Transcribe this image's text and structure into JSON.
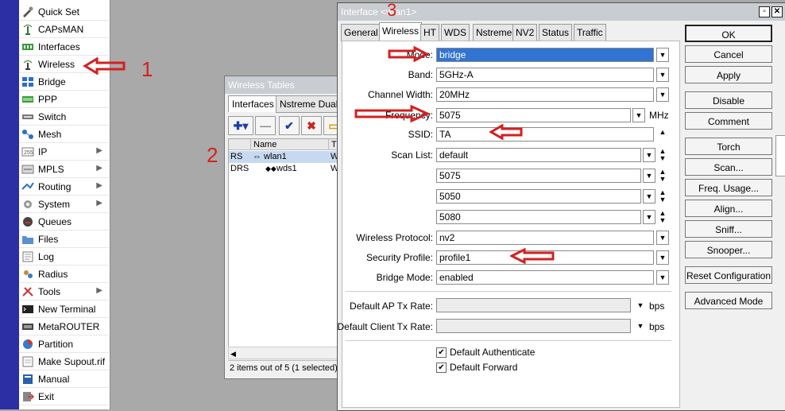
{
  "sidebar": {
    "items": [
      {
        "label": "Quick Set",
        "icon": "quick-set-icon"
      },
      {
        "label": "CAPsMAN",
        "icon": "capsman-icon"
      },
      {
        "label": "Interfaces",
        "icon": "interfaces-icon"
      },
      {
        "label": "Wireless",
        "icon": "wireless-icon"
      },
      {
        "label": "Bridge",
        "icon": "bridge-icon"
      },
      {
        "label": "PPP",
        "icon": "ppp-icon"
      },
      {
        "label": "Switch",
        "icon": "switch-icon"
      },
      {
        "label": "Mesh",
        "icon": "mesh-icon"
      },
      {
        "label": "IP",
        "icon": "ip-icon",
        "submenu": true
      },
      {
        "label": "MPLS",
        "icon": "mpls-icon",
        "submenu": true
      },
      {
        "label": "Routing",
        "icon": "routing-icon",
        "submenu": true
      },
      {
        "label": "System",
        "icon": "system-icon",
        "submenu": true
      },
      {
        "label": "Queues",
        "icon": "queues-icon"
      },
      {
        "label": "Files",
        "icon": "files-icon"
      },
      {
        "label": "Log",
        "icon": "log-icon"
      },
      {
        "label": "Radius",
        "icon": "radius-icon"
      },
      {
        "label": "Tools",
        "icon": "tools-icon",
        "submenu": true
      },
      {
        "label": "New Terminal",
        "icon": "terminal-icon"
      },
      {
        "label": "MetaROUTER",
        "icon": "metarouter-icon"
      },
      {
        "label": "Partition",
        "icon": "partition-icon"
      },
      {
        "label": "Make Supout.rif",
        "icon": "supout-icon"
      },
      {
        "label": "Manual",
        "icon": "manual-icon"
      },
      {
        "label": "Exit",
        "icon": "exit-icon"
      }
    ]
  },
  "wireless_tables": {
    "title": "Wireless Tables",
    "tabs": [
      "Interfaces",
      "Nstreme Dual"
    ],
    "columns": [
      "Name",
      "T"
    ],
    "rows": [
      {
        "flags": "RS",
        "name": "wlan1",
        "type": "W"
      },
      {
        "flags": "DRS",
        "name": "wds1",
        "type": "W"
      }
    ],
    "status": "2 items out of 5 (1 selected)"
  },
  "interface_dialog": {
    "title": "Interface <wlan1>",
    "tabs": [
      "General",
      "Wireless",
      "HT",
      "WDS",
      "Nstreme",
      "NV2",
      "Status",
      "Traffic"
    ],
    "active_tab": "Wireless",
    "fields": {
      "mode": {
        "label": "Mode:",
        "value": "bridge"
      },
      "band": {
        "label": "Band:",
        "value": "5GHz-A"
      },
      "channel_width": {
        "label": "Channel Width:",
        "value": "20MHz"
      },
      "frequency": {
        "label": "Frequency:",
        "value": "5075",
        "unit": "MHz"
      },
      "ssid": {
        "label": "SSID:",
        "value": "TA"
      },
      "scan_list": {
        "label": "Scan List:",
        "values": [
          "default",
          "5075",
          "5050",
          "5080"
        ]
      },
      "wireless_protocol": {
        "label": "Wireless Protocol:",
        "value": "nv2"
      },
      "security_profile": {
        "label": "Security Profile:",
        "value": "profile1"
      },
      "bridge_mode": {
        "label": "Bridge Mode:",
        "value": "enabled"
      },
      "default_ap_tx_rate": {
        "label": "Default AP Tx Rate:",
        "value": "",
        "unit": "bps"
      },
      "default_client_tx_rate": {
        "label": "Default Client Tx Rate:",
        "value": "",
        "unit": "bps"
      }
    },
    "checkboxes": {
      "default_authenticate": {
        "label": "Default Authenticate",
        "checked": true
      },
      "default_forward": {
        "label": "Default Forward",
        "checked": true
      }
    },
    "buttons": [
      "OK",
      "Cancel",
      "Apply",
      "Disable",
      "Comment",
      "Torch",
      "Scan...",
      "Freq. Usage...",
      "Align...",
      "Sniff...",
      "Snooper...",
      "Reset Configuration",
      "Advanced Mode"
    ]
  },
  "annotations": {
    "n1": "1",
    "n2": "2",
    "n3": "3",
    "arrow_color": "#d42020"
  },
  "colors": {
    "sidebar_strip": "#2b2fa3",
    "selection": "#3174d2",
    "desktop": "#a9a9a9"
  }
}
